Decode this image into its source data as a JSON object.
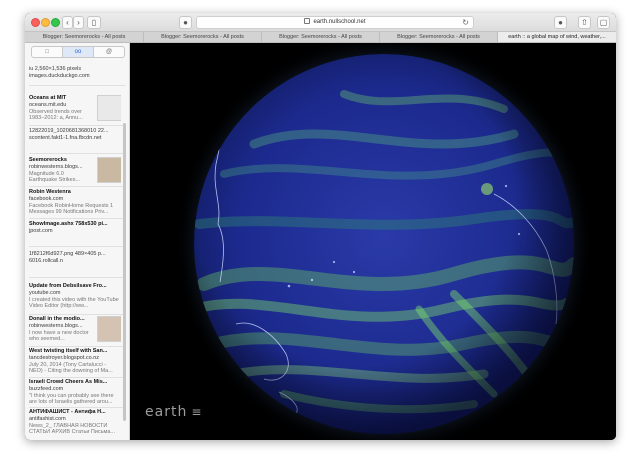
{
  "browser": {
    "url": "earth.nullschool.net",
    "tabs": [
      {
        "label": "Blogger: Seemorerocks - All posts",
        "active": false
      },
      {
        "label": "Blogger: Seemorerocks - All posts",
        "active": false
      },
      {
        "label": "Blogger: Seemorerocks - All posts",
        "active": false
      },
      {
        "label": "Blogger: Seemorerocks - All posts",
        "active": false
      },
      {
        "label": "earth :: a global map of wind, weather,...",
        "active": true
      }
    ]
  },
  "sidebar": {
    "segments": [
      "□",
      "oo",
      "@"
    ],
    "header": {
      "line1": "iu 2,560×1,536 pixels",
      "line2": "images.duckduckgo.com"
    },
    "items": [
      {
        "title": "Oceans at MIT",
        "source": "oceans.mit.edu",
        "desc": "Observed trends over 1983–2012: a, Annu..."
      },
      {
        "title": "12822019_1020681368010 22...",
        "source": "scontent.fakt1-1.fna.fbcdn.net",
        "desc": ""
      },
      {
        "title": "Seemorerocks",
        "source": "robinwesterns.blogs...",
        "desc": "Magnitude 6.0 Earthquake Strikes..."
      },
      {
        "title": "Robin Westenra",
        "source": "facebook.com",
        "desc": "Facebook RobinHome Requests 1 Messages 99 Notifications Priv..."
      },
      {
        "title": "ShowImage.ashx 758x530 pi...",
        "source": "jpost.com",
        "desc": ""
      },
      {
        "title": "1f8212f6d927.png 489×405 p...",
        "source": "6016.rollcall.n",
        "desc": ""
      },
      {
        "title": "Update from Debsilsave Fro...",
        "source": "youtube.com",
        "desc": "I created this video with the YouTube Video Editor (http://ww..."
      },
      {
        "title": "Donall in the modio...",
        "source": "robinwesterns.blogs...",
        "desc": "I now have a new doctor who seemed..."
      },
      {
        "title": "West twisting itself with San...",
        "source": "tancdestroyer.blogspot.co.nz",
        "desc": "July 20, 2014 (Tony Cartalucci - NEO) - Citing the downing of Ma..."
      },
      {
        "title": "Israeli Crowd Cheers As Mis...",
        "source": "buzzfeed.com",
        "desc": "\"I think you can probably see there are lots of Israelis gathered arou..."
      },
      {
        "title": "АНТИФАШИСТ - Антифа Н...",
        "source": "antifashist.com",
        "desc": "News_2_ ГЛАВНАЯ НОВОСТИ СТАТЬИ АРХИВ Статьи Письма..."
      }
    ]
  },
  "map": {
    "brand": "earth",
    "menu_icon": "≡",
    "colors": {
      "ocean": "#1c2a8e",
      "wind_fast": "#6fd35c",
      "wind_mid": "#2f8d6f",
      "coast": "#c7d2ff"
    }
  }
}
